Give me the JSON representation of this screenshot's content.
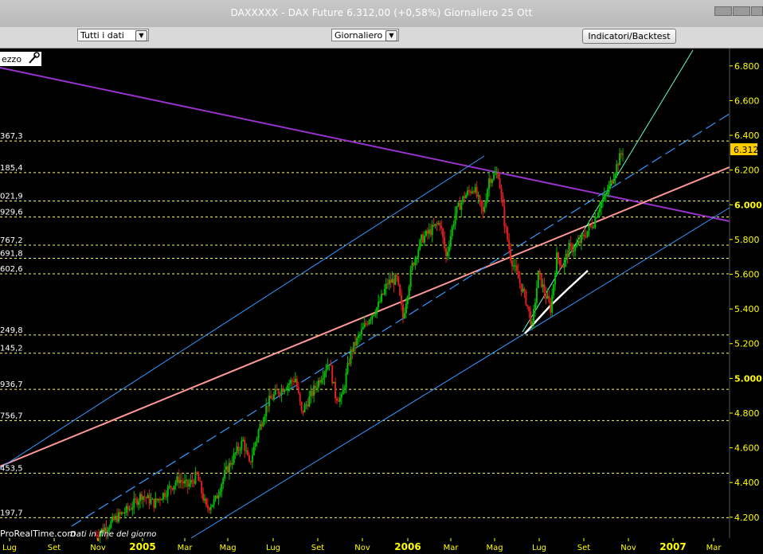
{
  "window": {
    "title": "DAXXXXX - DAX Future     6.312,00 (+0,58%)     Giornaliero  25 Ott"
  },
  "toolbar": {
    "data_select": "Tutti i dati",
    "period_select": "Giornaliero",
    "indicators_button": "Indicatori/Backtest"
  },
  "chart_panel": {
    "label": "ezzo",
    "footer_source": "ProRealTime.com",
    "footer_note": "Dati in fine del giorno"
  },
  "colors": {
    "background": "#000000",
    "up_candle": "#00c000",
    "down_candle": "#e02020",
    "level_lines": "#ffff66",
    "trend_purple": "#9933cc",
    "trend_pink": "#ff9999",
    "channel_blue": "#3399ff",
    "axis_text": "#ffff00",
    "price_badge": "#ffcc00"
  },
  "chart_data": {
    "type": "candlestick",
    "title": "DAX Future",
    "last_price": "6.312",
    "y_ticks": [
      "6.800",
      "6.600",
      "6.400",
      "6.200",
      "6.000",
      "5.800",
      "5.600",
      "5.400",
      "5.200",
      "5.000",
      "4.800",
      "4.600",
      "4.400",
      "4.200"
    ],
    "y_range": [
      4080,
      6900
    ],
    "x_ticks": [
      "Lug",
      "Set",
      "Nov",
      "2005",
      "Mar",
      "Mag",
      "Lug",
      "Set",
      "Nov",
      "2006",
      "Mar",
      "Mag",
      "Lug",
      "Set",
      "Nov",
      "2007",
      "Mar"
    ],
    "levels": [
      "367,3",
      "185,4",
      "021,9",
      "929,6",
      "767,2",
      "691,8",
      "602,6",
      "249,8",
      "145,2",
      "936,7",
      "756,7",
      "453,5",
      "197,7"
    ],
    "level_values": [
      6367.3,
      6185.4,
      6021.9,
      5929.6,
      5767.2,
      5691.8,
      5602.6,
      5249.8,
      5145.2,
      4936.7,
      4756.7,
      4453.5,
      4197.7
    ],
    "close_path": [
      [
        0,
        4100
      ],
      [
        8,
        4150
      ],
      [
        14,
        4200
      ],
      [
        22,
        4250
      ],
      [
        30,
        4330
      ],
      [
        38,
        4280
      ],
      [
        46,
        4350
      ],
      [
        54,
        4420
      ],
      [
        60,
        4380
      ],
      [
        66,
        4440
      ],
      [
        72,
        4250
      ],
      [
        78,
        4300
      ],
      [
        84,
        4450
      ],
      [
        90,
        4550
      ],
      [
        96,
        4640
      ],
      [
        100,
        4500
      ],
      [
        106,
        4700
      ],
      [
        112,
        4860
      ],
      [
        118,
        4920
      ],
      [
        124,
        4960
      ],
      [
        130,
        5000
      ],
      [
        134,
        4800
      ],
      [
        140,
        4900
      ],
      [
        146,
        5000
      ],
      [
        152,
        5100
      ],
      [
        156,
        4900
      ],
      [
        160,
        4880
      ],
      [
        166,
        5150
      ],
      [
        172,
        5250
      ],
      [
        178,
        5350
      ],
      [
        184,
        5420
      ],
      [
        190,
        5550
      ],
      [
        196,
        5570
      ],
      [
        200,
        5350
      ],
      [
        206,
        5650
      ],
      [
        212,
        5800
      ],
      [
        218,
        5850
      ],
      [
        224,
        5900
      ],
      [
        228,
        5700
      ],
      [
        234,
        5950
      ],
      [
        240,
        6050
      ],
      [
        246,
        6100
      ],
      [
        252,
        5950
      ],
      [
        256,
        6150
      ],
      [
        262,
        6180
      ],
      [
        266,
        5900
      ],
      [
        270,
        5700
      ],
      [
        276,
        5550
      ],
      [
        280,
        5450
      ],
      [
        284,
        5300
      ],
      [
        288,
        5600
      ],
      [
        292,
        5500
      ],
      [
        296,
        5400
      ],
      [
        300,
        5700
      ],
      [
        304,
        5650
      ],
      [
        308,
        5750
      ],
      [
        312,
        5750
      ],
      [
        316,
        5800
      ],
      [
        320,
        5850
      ],
      [
        324,
        5900
      ],
      [
        328,
        6000
      ],
      [
        332,
        6050
      ],
      [
        336,
        6150
      ],
      [
        340,
        6250
      ],
      [
        343,
        6312
      ]
    ]
  }
}
